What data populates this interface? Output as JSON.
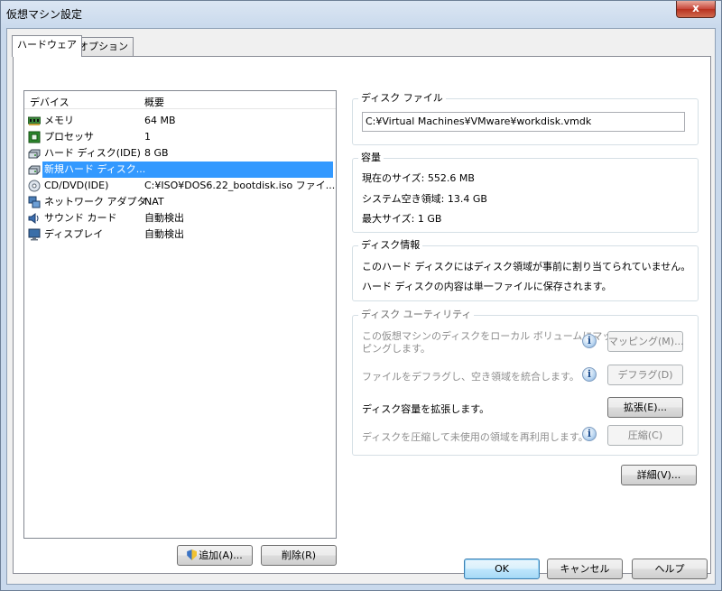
{
  "window": {
    "title": "仮想マシン設定",
    "close_glyph": "x"
  },
  "tabs": [
    {
      "label": "ハードウェア",
      "active": true
    },
    {
      "label": "オプション",
      "active": false
    }
  ],
  "device_list": {
    "columns": {
      "device": "デバイス",
      "summary": "概要"
    },
    "rows": [
      {
        "name": "メモリ",
        "summary": "64 MB",
        "icon": "memory-icon",
        "selected": false
      },
      {
        "name": "プロセッサ",
        "summary": "1",
        "icon": "processor-icon",
        "selected": false
      },
      {
        "name": "ハード ディスク(IDE)",
        "summary": "8 GB",
        "icon": "hard-disk-icon",
        "selected": false
      },
      {
        "name": "新規ハード ディスク...",
        "summary": "",
        "icon": "hard-disk-icon",
        "selected": true
      },
      {
        "name": "CD/DVD(IDE)",
        "summary": "C:¥ISO¥DOS6.22_bootdisk.iso ファイ...",
        "icon": "cd-dvd-icon",
        "selected": false
      },
      {
        "name": "ネットワーク アダプタ",
        "summary": "NAT",
        "icon": "network-adapter-icon",
        "selected": false
      },
      {
        "name": "サウンド カード",
        "summary": "自動検出",
        "icon": "sound-card-icon",
        "selected": false
      },
      {
        "name": "ディスプレイ",
        "summary": "自動検出",
        "icon": "display-icon",
        "selected": false
      }
    ]
  },
  "left_buttons": {
    "add": "追加(A)...",
    "remove": "削除(R)"
  },
  "disk_file": {
    "title": "ディスク ファイル",
    "path": "C:¥Virtual Machines¥VMware¥workdisk.vmdk"
  },
  "capacity": {
    "title": "容量",
    "current_size": "現在のサイズ: 552.6 MB",
    "free_space": "システム空き領域: 13.4 GB",
    "max_size": "最大サイズ: 1 GB"
  },
  "disk_info": {
    "title": "ディスク情報",
    "line1": "このハード ディスクにはディスク領域が事前に割り当てられていません。",
    "line2": "ハード ディスクの内容は単一ファイルに保存されます。"
  },
  "disk_utility": {
    "title": "ディスク ユーティリティ",
    "map_text_1": "この仮想マシンのディスクをローカル ボリュームにマッ",
    "map_text_2": "ピングします。",
    "map_button": "マッピング(M)...",
    "defrag_text": "ファイルをデフラグし、空き領域を統合します。",
    "defrag_button": "デフラグ(D)",
    "expand_text": "ディスク容量を拡張します。",
    "expand_button": "拡張(E)...",
    "compact_text": "ディスクを圧縮して未使用の領域を再利用します。",
    "compact_button": "圧縮(C)"
  },
  "advanced_button": "詳細(V)...",
  "footer": {
    "ok": "OK",
    "cancel": "キャンセル",
    "help": "ヘルプ"
  }
}
